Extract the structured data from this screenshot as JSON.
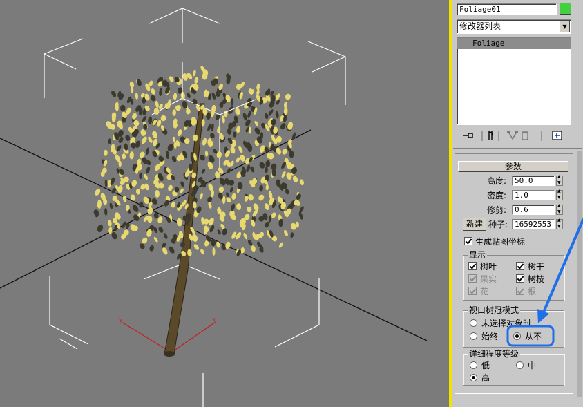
{
  "object": {
    "name": "Foliage01",
    "color": "#40d040"
  },
  "modifier_list": {
    "label": "修改器列表"
  },
  "stack": {
    "items": [
      "Foliage"
    ]
  },
  "rollout": {
    "collapse_sign": "-",
    "title": "参数"
  },
  "params": {
    "height": {
      "label": "高度:",
      "value": "50.0"
    },
    "density": {
      "label": "密度:",
      "value": "1.0"
    },
    "prune": {
      "label": "修剪:",
      "value": "0.6"
    },
    "new_label": "新建",
    "seed": {
      "label": "种子:",
      "value": "16592553"
    },
    "gen_map": {
      "label": "生成贴图坐标",
      "checked": true
    }
  },
  "display": {
    "title": "显示",
    "leaves": "树叶",
    "trunk": "树干",
    "fruit": "果实",
    "branches": "树枝",
    "flowers": "花",
    "roots": "根"
  },
  "canopy": {
    "title": "视口树冠模式",
    "when_unselected": "未选择对象时",
    "always": "始终",
    "never": "从不",
    "selected": "never"
  },
  "detail": {
    "title": "详细程度等级",
    "low": "低",
    "medium": "中",
    "high": "高",
    "selected": "high"
  },
  "gizmo_labels": {
    "x": "x",
    "y": "y"
  },
  "colors": {
    "viewport_bg": "#7b7b7b",
    "active_border": "#f2e200",
    "highlight": "#1e6fe8",
    "leaf": "#e8d870"
  }
}
